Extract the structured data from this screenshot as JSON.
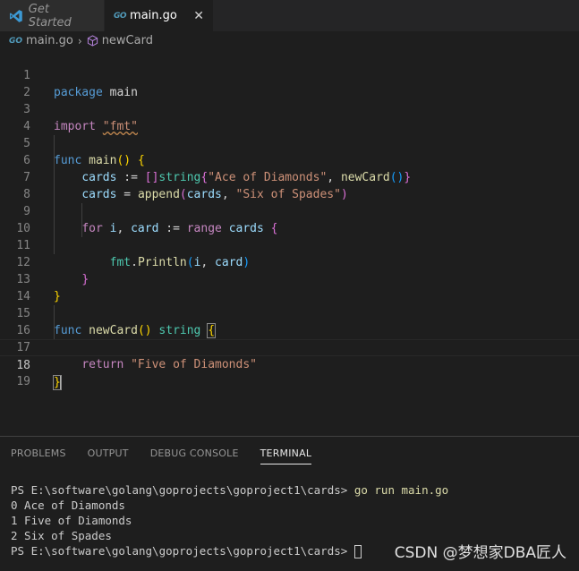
{
  "tabs": [
    {
      "label": "Get Started",
      "active": false
    },
    {
      "label": "main.go",
      "active": true,
      "close": "✕"
    }
  ],
  "go_icon_text": "GO",
  "breadcrumb": {
    "file": "main.go",
    "symbol": "newCard"
  },
  "line_numbers": [
    "1",
    "2",
    "3",
    "4",
    "5",
    "6",
    "7",
    "8",
    "9",
    "10",
    "11",
    "12",
    "13",
    "14",
    "15",
    "16",
    "17",
    "18",
    "19"
  ],
  "current_line": 18,
  "code": {
    "l1": {
      "kw": "package",
      "name": " main"
    },
    "l3": {
      "kw": "import",
      "str": "\"fmt\""
    },
    "l5": {
      "kw": "func",
      "fn": "main",
      "rest": "() {"
    },
    "l6": {
      "var": "cards",
      "op": " := ",
      "type": "string",
      "str": "\"Ace of Diamonds\"",
      "fn": "newCard"
    },
    "l7": {
      "var": "cards",
      "op": " = ",
      "fn": "append",
      "var2": "cards",
      "str": "\"Six of Spades\""
    },
    "l9": {
      "ctrl": "for",
      "var1": "i",
      "var2": "card",
      "op": ":=",
      "ctrl2": "range",
      "var3": "cards"
    },
    "l11": {
      "pkg": "fmt",
      "fn": "Println",
      "var1": "i",
      "var2": "card"
    },
    "l15": {
      "kw": "func",
      "fn": "newCard",
      "type": "string"
    },
    "l17": {
      "ctrl": "return",
      "str": "\"Five of Diamonds\""
    }
  },
  "panel": {
    "tabs": [
      "PROBLEMS",
      "OUTPUT",
      "DEBUG CONSOLE",
      "TERMINAL"
    ],
    "active_tab": "TERMINAL"
  },
  "terminal": {
    "prompt": "PS E:\\software\\golang\\goprojects\\goproject1\\cards> ",
    "command": "go run main.go",
    "output": [
      "0 Ace of Diamonds",
      "1 Five of Diamonds",
      "2 Six of Spades"
    ]
  },
  "watermark": "CSDN @梦想家DBA匠人"
}
